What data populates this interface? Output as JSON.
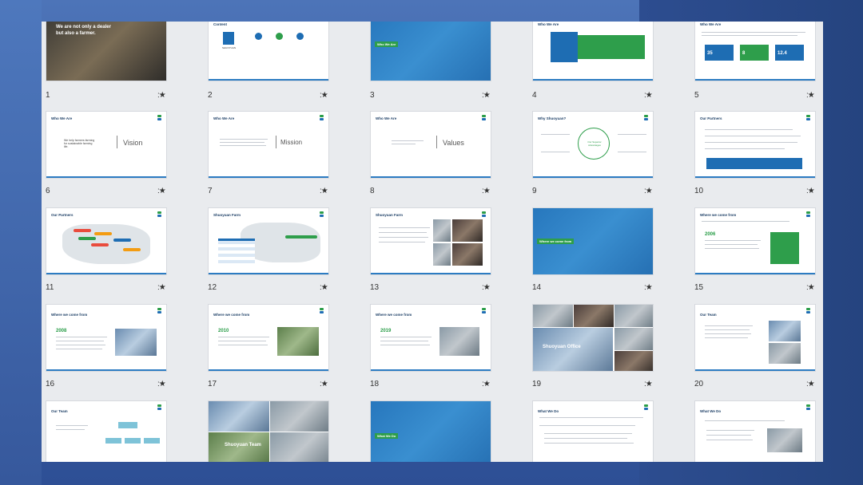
{
  "slides": [
    {
      "num": "1",
      "text": "We are not only a dealer but also a farmer."
    },
    {
      "num": "2",
      "title": "Content",
      "brand": "SHUOYUAN",
      "items": [
        "01",
        "02",
        "03"
      ]
    },
    {
      "num": "3",
      "label": "Who We Are"
    },
    {
      "num": "4",
      "title": "Who We Are"
    },
    {
      "num": "5",
      "title": "Who We Are",
      "stats": [
        "35",
        "8",
        "12.4"
      ]
    },
    {
      "num": "6",
      "title": "Who We Are",
      "word": "Vision",
      "sub": "We help farmers farming for sustainable farming life."
    },
    {
      "num": "7",
      "title": "Who We Are",
      "word": "Mission"
    },
    {
      "num": "8",
      "title": "Who We Are",
      "word": "Values"
    },
    {
      "num": "9",
      "title": "Why Shuoyuan?",
      "center": "Our Superior Advantages"
    },
    {
      "num": "10",
      "title": "Our Partners"
    },
    {
      "num": "11",
      "title": "Our Partners"
    },
    {
      "num": "12",
      "title": "Shuoyuan Farm"
    },
    {
      "num": "13",
      "title": "Shuoyuan Farm"
    },
    {
      "num": "14",
      "label": "Where we come from"
    },
    {
      "num": "15",
      "title": "Where we come from",
      "year": "2006"
    },
    {
      "num": "16",
      "title": "Where we come from",
      "year": "2008"
    },
    {
      "num": "17",
      "title": "Where we come from",
      "year": "2010"
    },
    {
      "num": "18",
      "title": "Where we come from",
      "year": "2019"
    },
    {
      "num": "19",
      "label": "Shuoyuan Office"
    },
    {
      "num": "20",
      "title": "Our Team"
    },
    {
      "num": "",
      "title": "Our Team"
    },
    {
      "num": "",
      "label": "Shuoyuan Team"
    },
    {
      "num": "",
      "label": "What We Do"
    },
    {
      "num": "",
      "title": "What We Do"
    },
    {
      "num": "",
      "title": "What We Do"
    }
  ],
  "star_glyph": "★",
  "colors": {
    "brand_blue": "#1e6db3",
    "brand_green": "#2e9e4b"
  }
}
